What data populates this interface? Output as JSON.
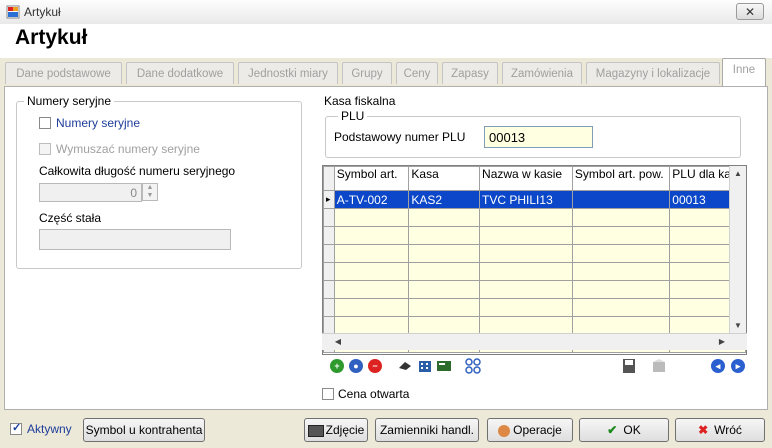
{
  "window": {
    "title": "Artykuł",
    "close_glyph": "✕"
  },
  "page": {
    "title": "Artykuł"
  },
  "tabs": [
    {
      "label": "Dane podstawowe"
    },
    {
      "label": "Dane dodatkowe"
    },
    {
      "label": "Jednostki miary"
    },
    {
      "label": "Grupy"
    },
    {
      "label": "Ceny"
    },
    {
      "label": "Zapasy"
    },
    {
      "label": "Zamówienia"
    },
    {
      "label": "Magazyny i lokalizacje"
    },
    {
      "label": "Inne",
      "active": true
    }
  ],
  "serial": {
    "legend": "Numery seryjne",
    "numery_seryjne_label": "Numery seryjne",
    "wymuszac_label": "Wymuszać numery seryjne",
    "total_length_label": "Całkowita długość numeru seryjnego",
    "total_length_value": "0",
    "fixed_part_label": "Część stała",
    "fixed_part_value": ""
  },
  "kasa": {
    "legend": "Kasa fiskalna",
    "plu_legend": "PLU",
    "plu_label": "Podstawowy numer PLU",
    "plu_value": "00013",
    "columns": [
      "Symbol art.",
      "Kasa",
      "Nazwa w kasie",
      "Symbol art. pow.",
      "PLU dla kasy"
    ],
    "rows": [
      {
        "symbol": "A-TV-002",
        "kasa": "KAS2",
        "nazwa": "TVC PHILI13",
        "symbol_pow": "",
        "plu": "00013"
      }
    ],
    "indicator": "▸",
    "cena_otwarta_label": "Cena otwarta"
  },
  "footer": {
    "aktywny_label": "Aktywny",
    "symbol_kontrahenta": "Symbol u kontrahenta",
    "zdjecie": "Zdjęcie",
    "zamienniki": "Zamienniki handl.",
    "operacje": "Operacje",
    "ok": "OK",
    "wroc": "Wróć"
  },
  "colors": {
    "selection": "#0b47c8",
    "row_bg": "#ffffe1",
    "tab_text": "#a0a0a0"
  }
}
